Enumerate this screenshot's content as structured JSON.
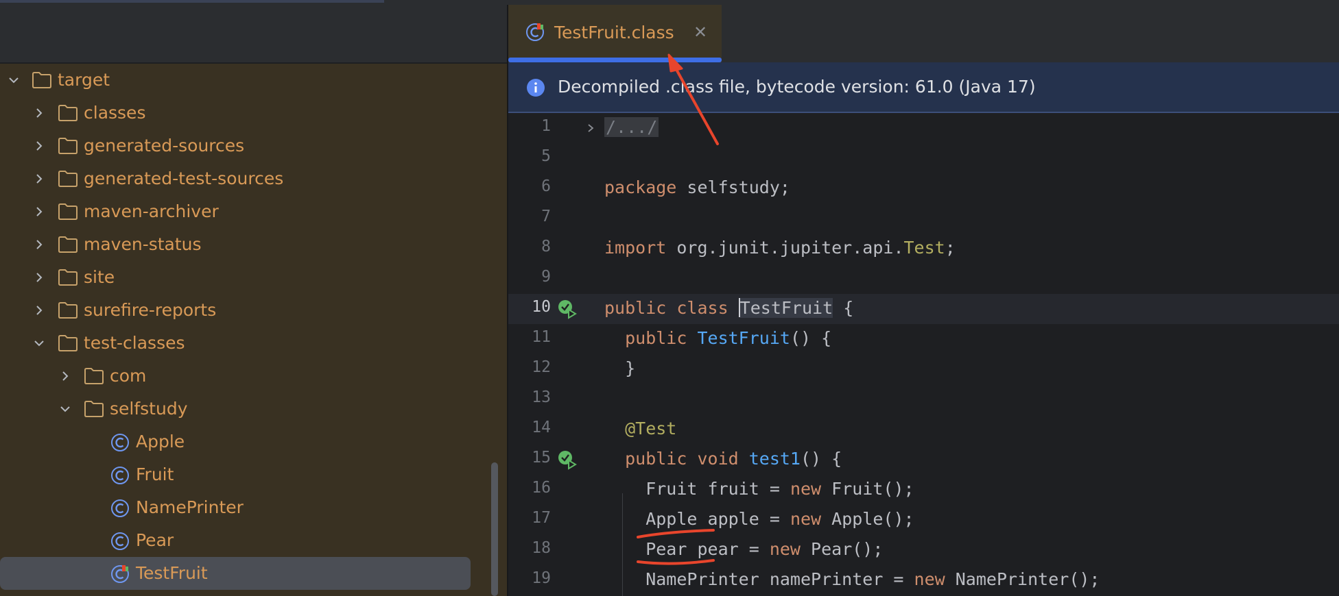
{
  "project_tree": {
    "items": [
      {
        "label": "target",
        "kind": "folder",
        "expanded": true
      },
      {
        "label": "classes",
        "kind": "folder",
        "expanded": false
      },
      {
        "label": "generated-sources",
        "kind": "folder",
        "expanded": false
      },
      {
        "label": "generated-test-sources",
        "kind": "folder",
        "expanded": false
      },
      {
        "label": "maven-archiver",
        "kind": "folder",
        "expanded": false
      },
      {
        "label": "maven-status",
        "kind": "folder",
        "expanded": false
      },
      {
        "label": "site",
        "kind": "folder",
        "expanded": false
      },
      {
        "label": "surefire-reports",
        "kind": "folder",
        "expanded": false
      },
      {
        "label": "test-classes",
        "kind": "folder",
        "expanded": true
      },
      {
        "label": "com",
        "kind": "folder",
        "expanded": false
      },
      {
        "label": "selfstudy",
        "kind": "folder",
        "expanded": true
      },
      {
        "label": "Apple",
        "kind": "class"
      },
      {
        "label": "Fruit",
        "kind": "class"
      },
      {
        "label": "NamePrinter",
        "kind": "class"
      },
      {
        "label": "Pear",
        "kind": "class"
      },
      {
        "label": "TestFruit",
        "kind": "test-class",
        "selected": true
      }
    ]
  },
  "editor": {
    "tab": {
      "title": "TestFruit.class",
      "close_glyph": "✕",
      "icon": "test-class-icon"
    },
    "banner": {
      "text": "Decompiled .class file, bytecode version: 61.0 (Java 17)",
      "icon": "info-icon"
    },
    "line_numbers": [
      "1",
      "5",
      "6",
      "7",
      "8",
      "9",
      "10",
      "11",
      "12",
      "13",
      "14",
      "15",
      "16",
      "17",
      "18",
      "19"
    ],
    "code": {
      "l1": "/.../",
      "l6_kw": "package",
      "l6_rest": " selfstudy;",
      "l8_kw": "import",
      "l8_pkg": " org.junit.jupiter.api.",
      "l8_type": "Test",
      "l8_end": ";",
      "l10_kw": "public class ",
      "l10_name": "TestFruit",
      "l10_end": " {",
      "l11_kw": "  public ",
      "l11_fn": "TestFruit",
      "l11_end": "() {",
      "l12": "  }",
      "l14_ann": "  @Test",
      "l15_kw": "  public void ",
      "l15_fn": "test1",
      "l15_end": "() {",
      "l16_a": "    Fruit fruit = ",
      "l16_kw": "new",
      "l16_b": " Fruit();",
      "l17_a": "    Apple apple = ",
      "l17_kw": "new",
      "l17_b": " Apple();",
      "l18_a": "    Pear pear = ",
      "l18_kw": "new",
      "l18_b": " Pear();",
      "l19_a": "    NamePrinter namePrinter = ",
      "l19_kw": "new",
      "l19_b": " NamePrinter();"
    }
  },
  "colors": {
    "folder_label": "#d99a57",
    "keyword": "#cf8e6d",
    "function": "#56a8f5",
    "annotation": "#b3ae60",
    "tab_underline": "#3e6ee6",
    "annotation_marks": "#e8452c"
  }
}
